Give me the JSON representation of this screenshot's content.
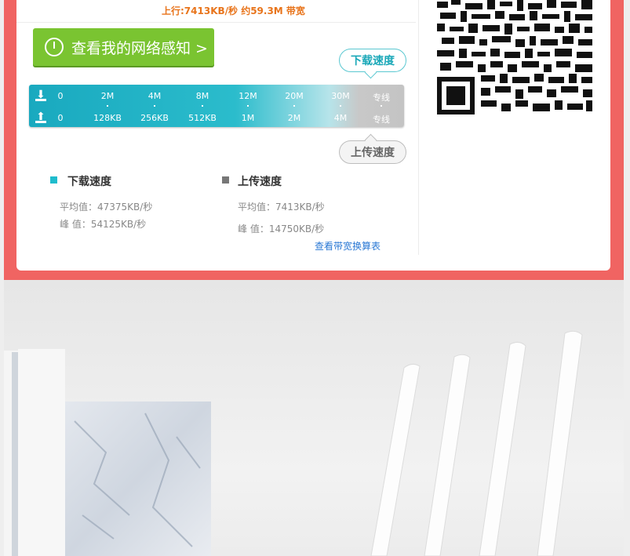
{
  "header": {
    "upload_line": "上行:7413KB/秒 约59.3M 带宽"
  },
  "network_button": {
    "label": "查看我的网络感知 >"
  },
  "bubbles": {
    "download": "下载速度",
    "upload": "上传速度"
  },
  "scale": {
    "download_labels": [
      "0",
      "2M",
      "4M",
      "8M",
      "12M",
      "20M",
      "30M",
      "专线"
    ],
    "upload_labels": [
      "0",
      "128KB",
      "256KB",
      "512KB",
      "1M",
      "2M",
      "4M",
      "专线"
    ],
    "download_icon": "download-icon",
    "upload_icon": "upload-icon"
  },
  "stats": {
    "download": {
      "title": "下载速度",
      "avg": "平均值：47375KB/秒",
      "peak": "峰 值：54125KB/秒",
      "color": "#1fbccd"
    },
    "upload": {
      "title": "上传速度",
      "avg": "平均值：7413KB/秒",
      "peak": "峰 值：14750KB/秒",
      "color": "#777777"
    }
  },
  "calc_link": "查看带宽换算表",
  "colors": {
    "frame": "#f06462",
    "accent_green": "#7ac431",
    "accent_teal": "#1aa8b8",
    "upload_orange": "#e8741b",
    "link_blue": "#2a78d4"
  },
  "qr_code": "qr-code-icon"
}
